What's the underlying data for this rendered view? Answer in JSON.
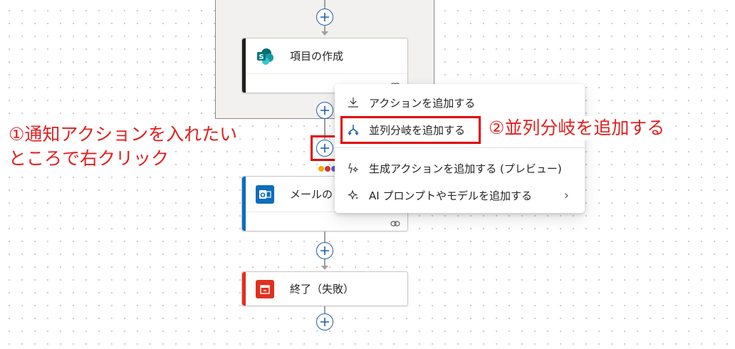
{
  "cards": {
    "create_item": {
      "title": "項目の作成",
      "accent": "#201f1e",
      "icon": "sharepoint-icon"
    },
    "mail": {
      "title": "メールの",
      "accent": "#0f6cbd",
      "icon": "outlook-icon"
    },
    "terminate": {
      "title": "終了（失敗）",
      "accent": "#e0301e",
      "icon": "terminate-icon"
    }
  },
  "context_menu": {
    "items": [
      {
        "label": "アクションを追加する",
        "icon": "add-action-icon"
      },
      {
        "label": "並列分岐を追加する",
        "icon": "parallel-branch-icon"
      },
      {
        "label": "生成アクションを追加する (プレビュー)",
        "icon": "generative-action-icon"
      },
      {
        "label": "AI プロンプトやモデルを追加する",
        "icon": "ai-sparkle-icon",
        "submenu": true
      }
    ]
  },
  "annotations": {
    "step1_line1": "①通知アクションを入れたい",
    "step1_line2": "ところで右クリック",
    "step2": "②並列分岐を追加する"
  },
  "colors": {
    "annotation": "#e02020",
    "plus": "#1f5fa8",
    "connector": "#a19f9d"
  }
}
